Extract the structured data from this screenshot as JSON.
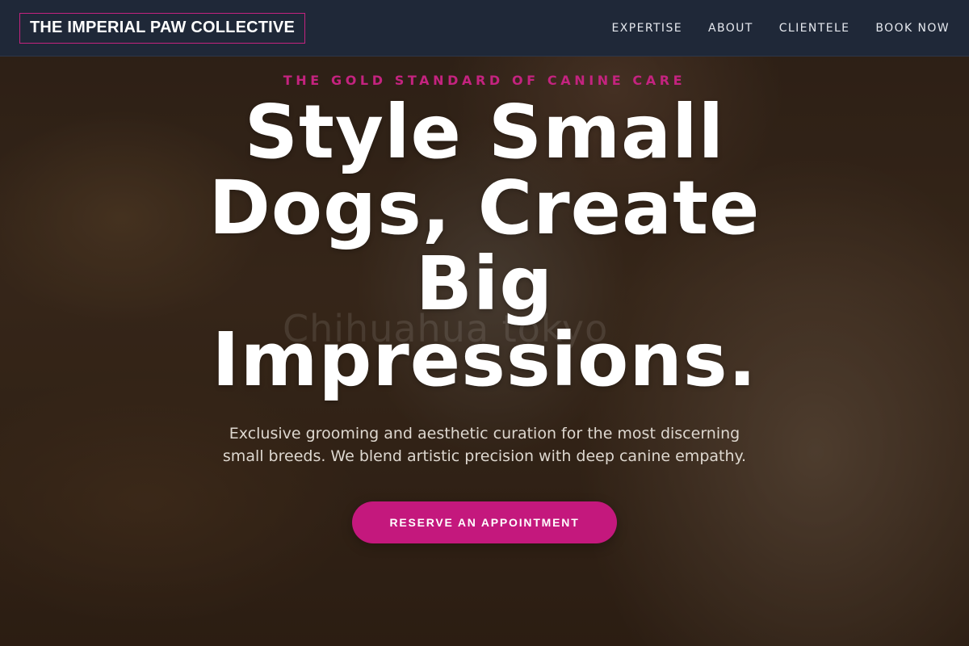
{
  "nav": {
    "logo": "THE IMPERIAL PAW COLLECTIVE",
    "links": [
      "EXPERTISE",
      "ABOUT",
      "CLIENTELE",
      "BOOK NOW"
    ]
  },
  "hero": {
    "eyebrow": "THE GOLD STANDARD OF CANINE CARE",
    "headline": "Style Small Dogs, Create Big Impressions.",
    "subtext": "Exclusive grooming and aesthetic curation for the most discerning small breeds. We blend artistic precision with deep canine empathy.",
    "cta_label": "RESERVE AN APPOINTMENT",
    "watermark": "Chihuahua tokyo"
  },
  "colors": {
    "accent": "#c4187d",
    "nav_background": "#1f2838",
    "text_primary": "#ffffff"
  }
}
